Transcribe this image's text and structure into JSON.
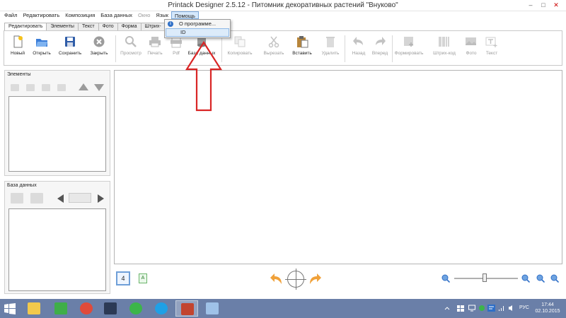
{
  "window": {
    "title": "Printack Designer 2.5.12 - Питомник декоративных растений \"Внуково\"",
    "min": "–",
    "max": "□",
    "close": "✕"
  },
  "menu": {
    "items": [
      "Файл",
      "Редактировать",
      "Композиция",
      "База данных",
      "Окно",
      "Язык",
      "Помощь"
    ],
    "open_menu": {
      "items": [
        "О программе...",
        "ID"
      ]
    }
  },
  "tabs": [
    "Редактировать",
    "Элементы",
    "Текст",
    "Фото",
    "Форма",
    "Штрих-"
  ],
  "toolbar": {
    "new": "Новый",
    "open": "Открыть",
    "save": "Сохранить",
    "close": "Закрыть",
    "preview": "Просмотр",
    "print": "Печать",
    "pdf": "Pdf",
    "database": "База данных",
    "copy": "Копировать",
    "cut": "Вырезать",
    "paste": "Вставить",
    "delete": "Удалить",
    "back": "Назад",
    "forward": "Вперед",
    "format": "Формировать",
    "barcode": "Штрих-код",
    "photo": "Фото",
    "text": "Текст"
  },
  "panels": {
    "elements_title": "Элементы",
    "database_title": "База данных"
  },
  "bottom": {
    "page_number": "4",
    "add_page": "A"
  },
  "tray": {
    "lang": "РУС",
    "time": "17:44",
    "date": "02.10.2015"
  },
  "colors": {
    "accent": "#2f6fc7",
    "annotation": "#d92525",
    "taskbar": "#6a7fa8"
  }
}
